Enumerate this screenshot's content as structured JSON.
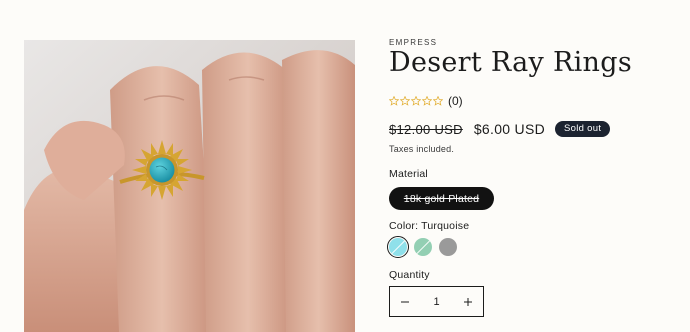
{
  "product": {
    "vendor": "EMPRESS",
    "title": "Desert Ray Rings",
    "rating": {
      "stars_filled": 0,
      "stars_total": 5,
      "count_text": "(0)"
    },
    "price": {
      "compare_at": "$12.00 USD",
      "sale": "$6.00 USD",
      "badge": "Sold out"
    },
    "taxes_note": "Taxes included.",
    "material": {
      "label": "Material",
      "selected": "18k gold Plated",
      "unavailable": true
    },
    "color": {
      "label": "Color: Turquoise",
      "swatches": [
        {
          "name": "Turquoise",
          "hex": "#8fe0ea",
          "selected": true,
          "unavailable": true
        },
        {
          "name": "Green",
          "hex": "#93cfb3",
          "selected": false,
          "unavailable": true
        },
        {
          "name": "Gray",
          "hex": "#9a9a9a",
          "selected": false,
          "unavailable": false
        }
      ]
    },
    "quantity": {
      "label": "Quantity",
      "value": "1",
      "minus_icon": "minus-icon",
      "plus_icon": "plus-icon"
    }
  },
  "colors": {
    "badge_bg": "#1c2330",
    "star": "#e3b23c",
    "text": "#1c1c1c",
    "page_bg": "#fdfcf9"
  }
}
